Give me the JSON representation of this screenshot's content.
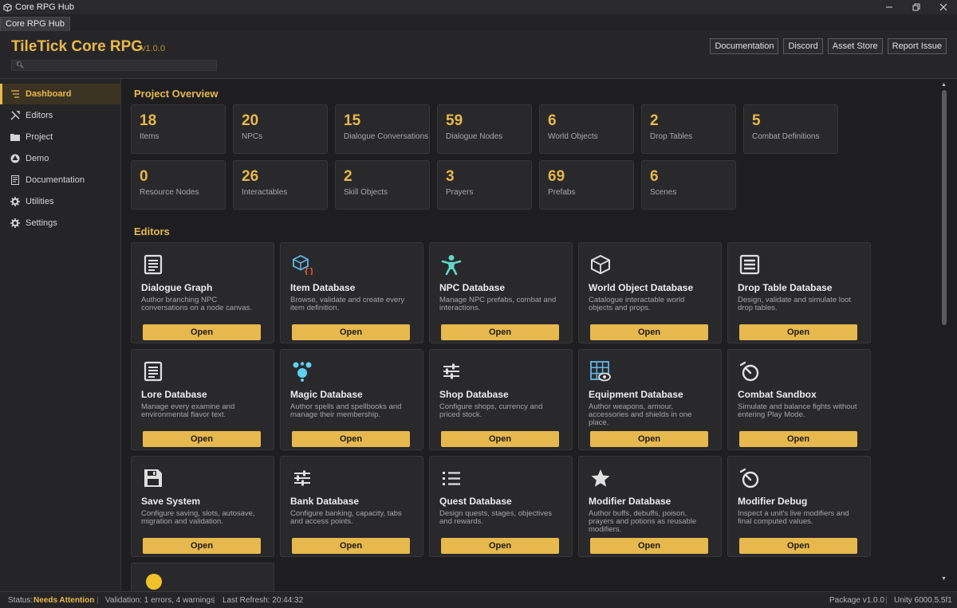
{
  "window": {
    "title": "Core RPG Hub",
    "tab_label": "Core RPG Hub"
  },
  "header": {
    "brand": "TileTick Core RPG",
    "version": "v1.0.0",
    "buttons": [
      "Documentation",
      "Discord",
      "Asset Store",
      "Report Issue"
    ]
  },
  "sidebar": {
    "items": [
      {
        "label": "Dashboard",
        "icon": "list-icon",
        "active": true
      },
      {
        "label": "Editors",
        "icon": "tools-icon"
      },
      {
        "label": "Project",
        "icon": "folder-icon"
      },
      {
        "label": "Demo",
        "icon": "unity-icon"
      },
      {
        "label": "Documentation",
        "icon": "document-icon"
      },
      {
        "label": "Utilities",
        "icon": "gear-icon"
      },
      {
        "label": "Settings",
        "icon": "gear-icon"
      }
    ]
  },
  "overview": {
    "title": "Project Overview",
    "stats": [
      {
        "value": "18",
        "label": "Items"
      },
      {
        "value": "20",
        "label": "NPCs"
      },
      {
        "value": "15",
        "label": "Dialogue Conversations"
      },
      {
        "value": "59",
        "label": "Dialogue Nodes"
      },
      {
        "value": "6",
        "label": "World Objects"
      },
      {
        "value": "2",
        "label": "Drop Tables"
      },
      {
        "value": "5",
        "label": "Combat Definitions"
      },
      {
        "value": "0",
        "label": "Resource Nodes"
      },
      {
        "value": "26",
        "label": "Interactables"
      },
      {
        "value": "2",
        "label": "Skill Objects"
      },
      {
        "value": "3",
        "label": "Prayers"
      },
      {
        "value": "69",
        "label": "Prefabs"
      },
      {
        "value": "6",
        "label": "Scenes"
      }
    ]
  },
  "editors": {
    "title": "Editors",
    "button_label": "Open",
    "cards": [
      {
        "title": "Dialogue Graph",
        "desc": "Author branching NPC conversations on a node canvas.",
        "icon": "document-icon"
      },
      {
        "title": "Item Database",
        "desc": "Browse, validate and create every item definition.",
        "icon": "cube-code-icon"
      },
      {
        "title": "NPC Database",
        "desc": "Manage NPC prefabs, combat and interactions.",
        "icon": "person-icon"
      },
      {
        "title": "World Object Database",
        "desc": "Catalogue interactable world objects and props.",
        "icon": "cube-icon"
      },
      {
        "title": "Drop Table Database",
        "desc": "Design, validate and simulate loot drop tables.",
        "icon": "table-icon"
      },
      {
        "title": "Lore Database",
        "desc": "Manage every examine and environmental flavor text.",
        "icon": "document-icon"
      },
      {
        "title": "Magic Database",
        "desc": "Author spells and spellbooks and manage their membership.",
        "icon": "magic-icon"
      },
      {
        "title": "Shop Database",
        "desc": "Configure shops, currency and priced stock.",
        "icon": "sliders-icon"
      },
      {
        "title": "Equipment Database",
        "desc": "Author weapons, armour, accessories and shields in one place.",
        "icon": "grid-eye-icon"
      },
      {
        "title": "Combat Sandbox",
        "desc": "Simulate and balance fights without entering Play Mode.",
        "icon": "stopwatch-icon"
      },
      {
        "title": "Save System",
        "desc": "Configure saving, slots, autosave, migration and validation.",
        "icon": "floppy-icon"
      },
      {
        "title": "Bank Database",
        "desc": "Configure banking, capacity, tabs and access points.",
        "icon": "sliders-icon"
      },
      {
        "title": "Quest Database",
        "desc": "Design quests, stages, objectives and rewards.",
        "icon": "checklist-icon"
      },
      {
        "title": "Modifier Database",
        "desc": "Author buffs, debuffs, poison, prayers and potions as reusable modifiers.",
        "icon": "star-icon"
      },
      {
        "title": "Modifier Debug",
        "desc": "Inspect a unit's live modifiers and final computed values.",
        "icon": "stopwatch-icon"
      }
    ]
  },
  "status": {
    "status_label": "Status:",
    "status_value": "Needs Attention",
    "validation": "Validation: 1 errors, 4 warnings",
    "last_refresh": "Last Refresh: 20:44:32",
    "package": "Package v1.0.0",
    "unity": "Unity 6000.5.5f1"
  },
  "colors": {
    "accent": "#e8b849",
    "background": "#1e1e21",
    "card": "#29292c",
    "button": "#e6b84d"
  }
}
